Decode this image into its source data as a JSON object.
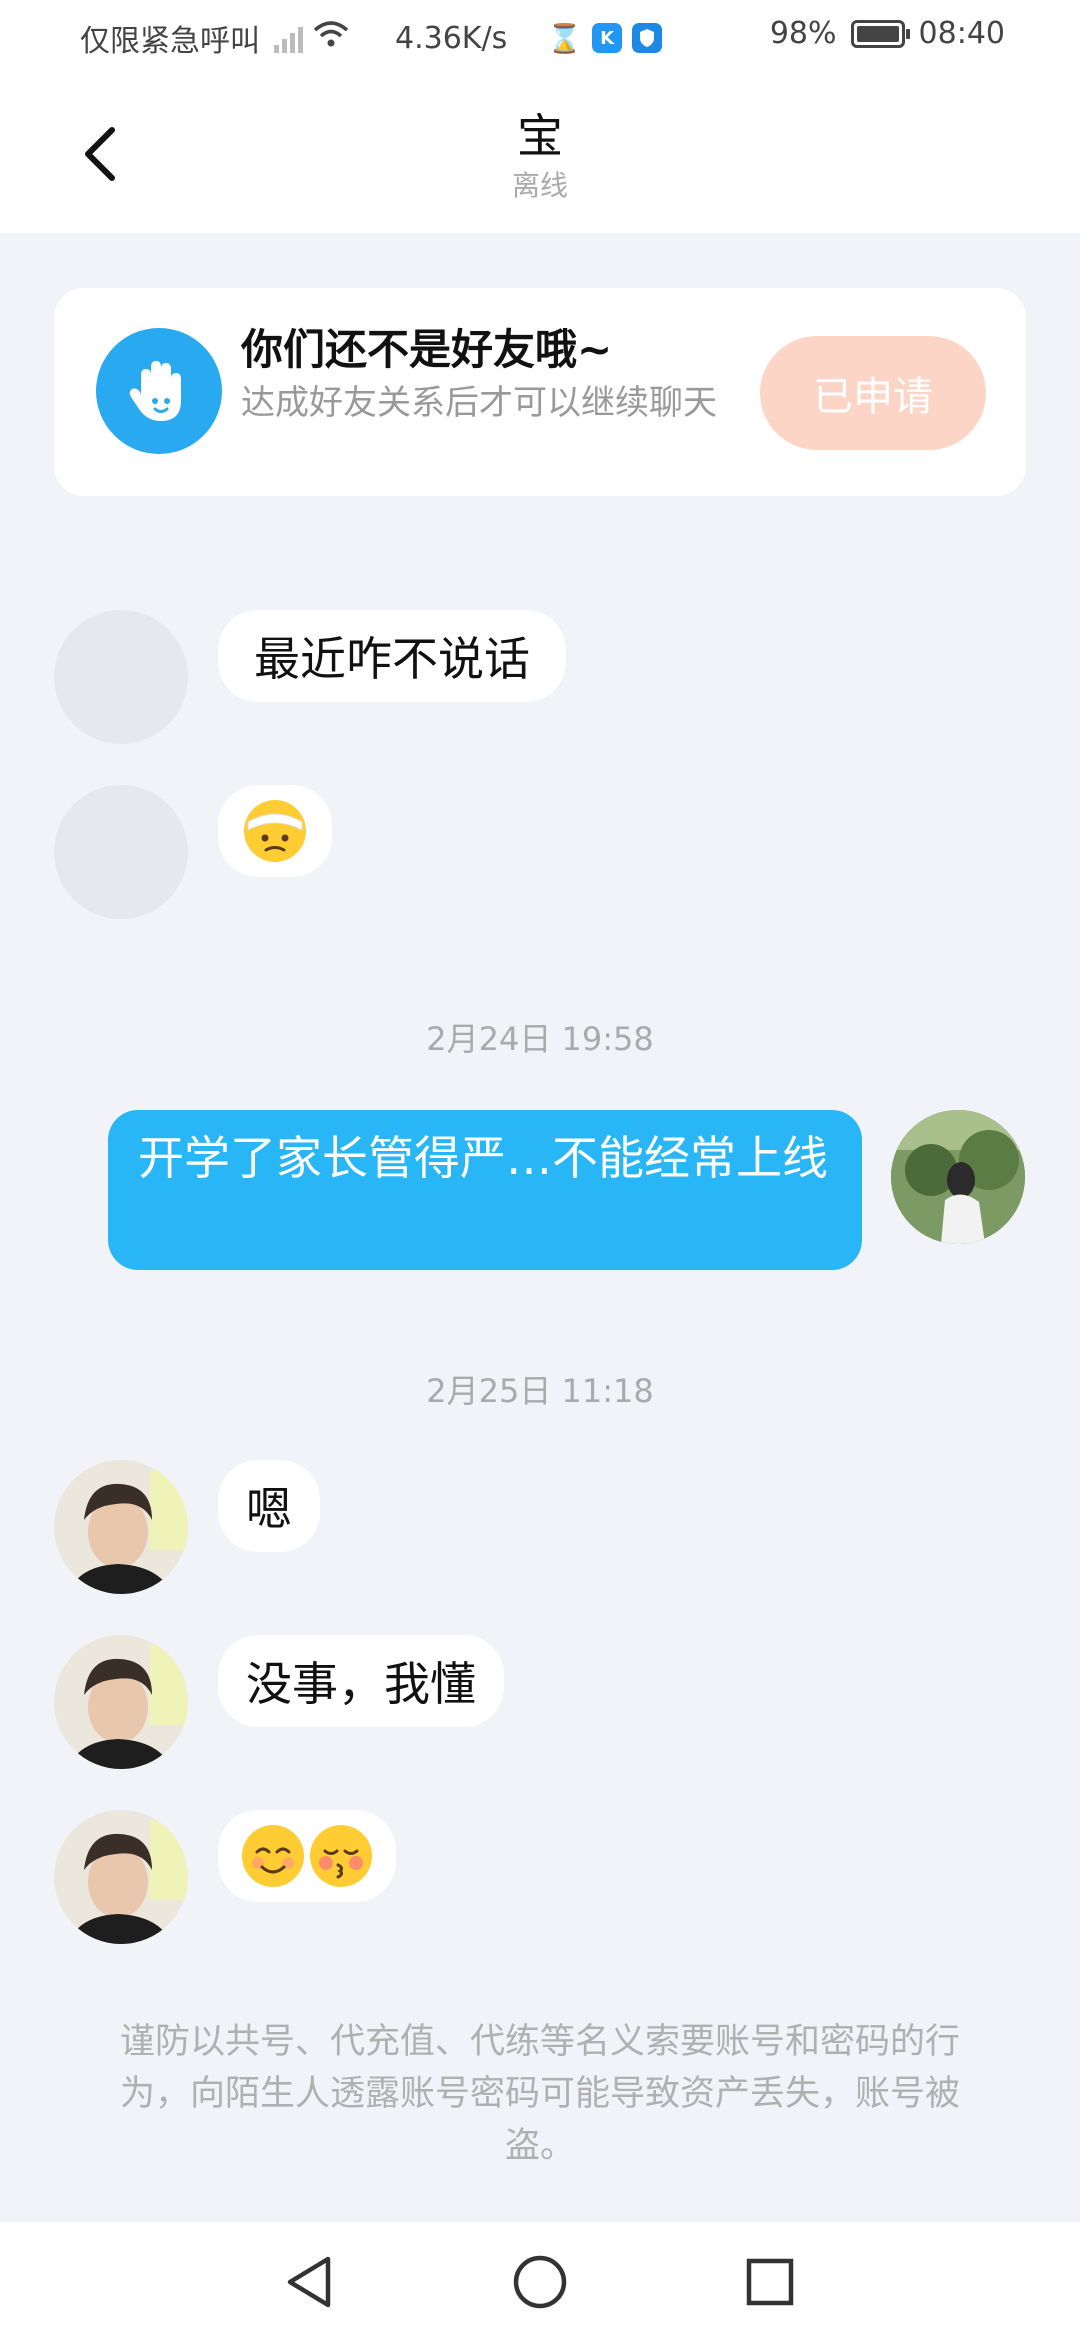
{
  "status_bar": {
    "carrier_text": "仅限紧急呼叫",
    "speed": "4.36K/s",
    "battery_percent": "98%",
    "time": "08:40",
    "icons": [
      "signal-icon",
      "wifi-icon",
      "hourglass-icon",
      "app-k-icon",
      "shield-app-icon",
      "battery-icon"
    ]
  },
  "header": {
    "title": "宝",
    "status": "离线"
  },
  "friend_card": {
    "title": "你们还不是好友哦~",
    "description": "达成好友关系后才可以继续聊天",
    "button_label": "已申请"
  },
  "messages": [
    {
      "sender": "other",
      "avatar": "placeholder",
      "text": "最近咋不说话"
    },
    {
      "sender": "other",
      "avatar": "placeholder",
      "emoji": [
        "bandaged-face-emoji"
      ]
    },
    {
      "timestamp": "2月24日 19:58"
    },
    {
      "sender": "me",
      "avatar": "photo",
      "text": "开学了家长管得严…不能经常上线"
    },
    {
      "timestamp": "2月25日 11:18"
    },
    {
      "sender": "other",
      "avatar": "photo",
      "text": "嗯"
    },
    {
      "sender": "other",
      "avatar": "photo",
      "text": "没事，我懂"
    },
    {
      "sender": "other",
      "avatar": "photo",
      "emoji": [
        "smiling-face-emoji",
        "kissing-face-emoji"
      ]
    }
  ],
  "notice": "谨防以共号、代充值、代练等名义索要账号和密码的行为，向陌生人透露账号密码可能导致资产丢失，账号被盗。",
  "colors": {
    "background": "#f1f3f8",
    "my_bubble": "#29b6f6",
    "applied_button": "#fcd5c6",
    "hand_icon": "#29a9f0"
  },
  "nav_bar": {
    "buttons": [
      "back-triangle-icon",
      "home-circle-icon",
      "recents-square-icon"
    ]
  }
}
